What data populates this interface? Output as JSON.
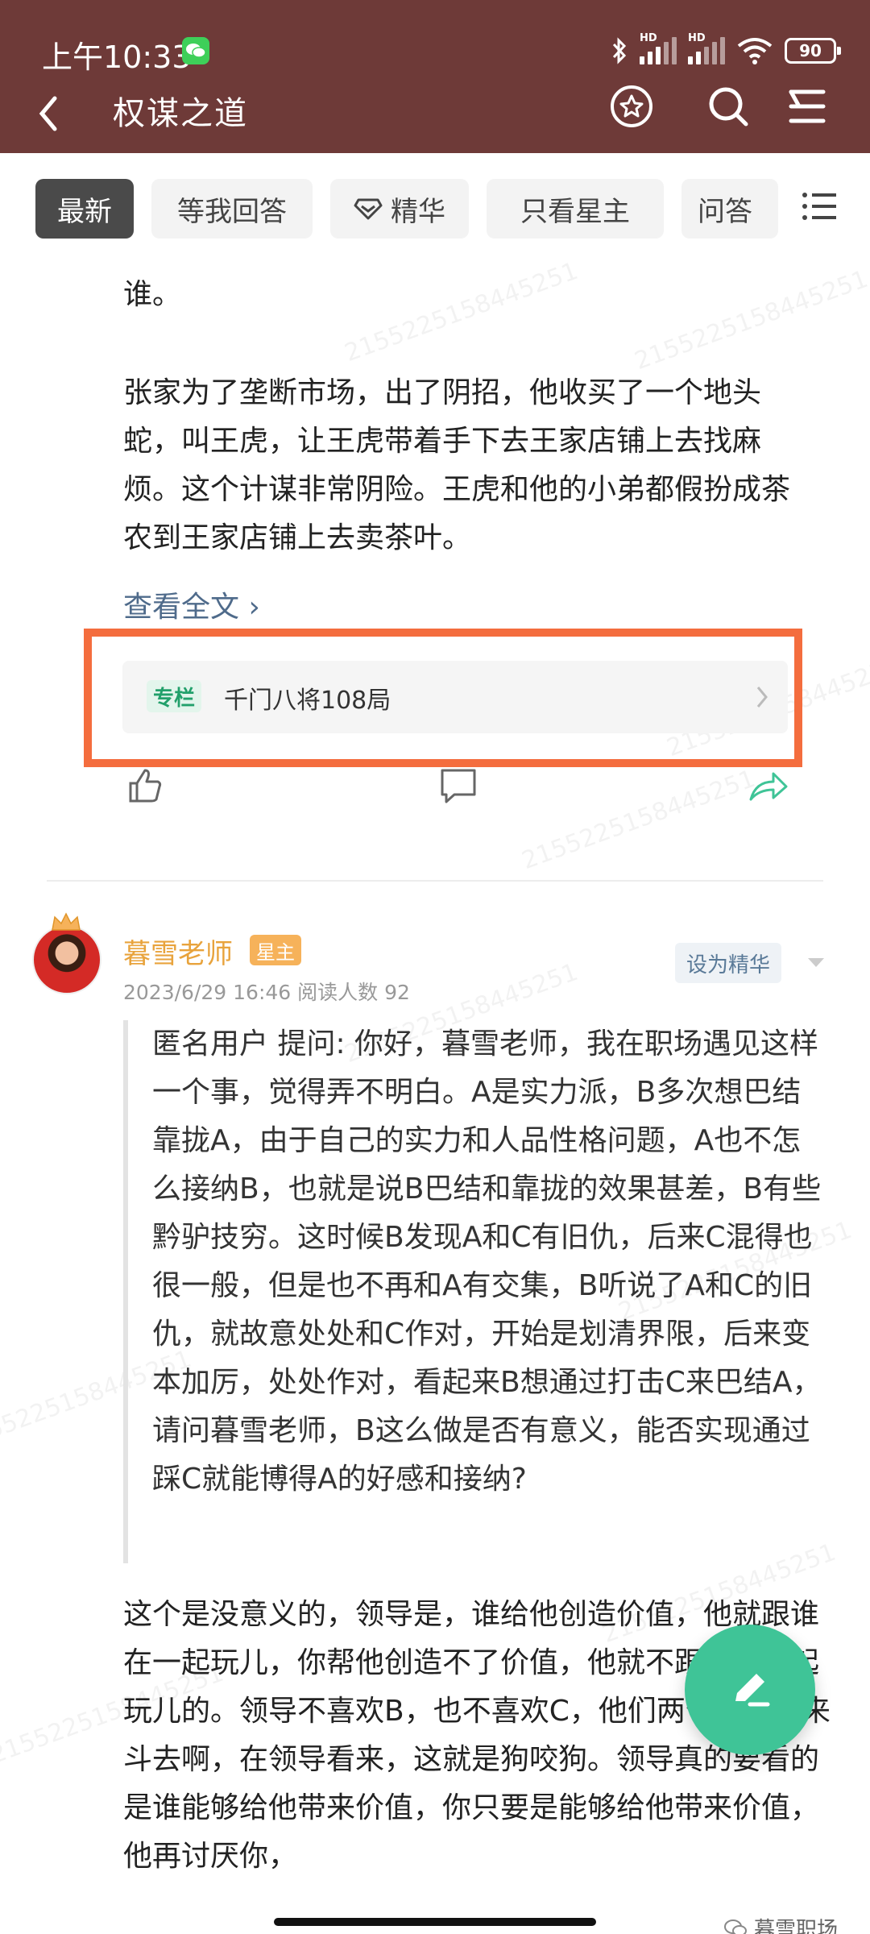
{
  "status": {
    "time": "上午10:33",
    "battery": "90",
    "sig_label": "HD"
  },
  "nav": {
    "title": "权谋之道"
  },
  "tabs": [
    {
      "label": "最新"
    },
    {
      "label": "等我回答"
    },
    {
      "label": "精华"
    },
    {
      "label": "只看星主"
    },
    {
      "label": "问答"
    }
  ],
  "article1": {
    "line0": "谁。",
    "paragraph": "张家为了垄断市场，出了阴招，他收买了一个地头蛇，叫王虎，让王虎带着手下去王家店铺上去找麻烦。这个计谋非常阴险。王虎和他的小弟都假扮成茶农到王家店铺上去卖茶叶。",
    "read_more": "查看全文 ›",
    "column_tag": "专栏",
    "column_title": "千门八将108局"
  },
  "post2": {
    "author": "暮雪老师",
    "author_badge": "星主",
    "meta": "2023/6/29 16:46  阅读人数 92",
    "feature_button": "设为精华",
    "question": "匿名用户 提问: 你好，暮雪老师，我在职场遇见这样一个事，觉得弄不明白。A是实力派，B多次想巴结靠拢A，由于自己的实力和人品性格问题，A也不怎么接纳B，也就是说B巴结和靠拢的效果甚差，B有些黔驴技穷。这时候B发现A和C有旧仇，后来C混得也很一般，但是也不再和A有交集，B听说了A和C的旧仇，就故意处处和C作对，开始是划清界限，后来变本加厉，处处作对，看起来B想通过打击C来巴结A，请问暮雪老师，B这么做是否有意义，能否实现通过踩C就能博得A的好感和接纳?",
    "answer": "这个是没意义的，领导是，谁给他创造价值，他就跟谁在一起玩儿，你帮他创造不了价值，他就不跟你在一起玩儿的。领导不喜欢B，也不喜欢C，他们两个相互斗来斗去啊，在领导看来，这就是狗咬狗。领导真的要看的是谁能够给他带来价值，你只要是能够给他带来价值，他再讨厌你，"
  },
  "footer": {
    "wechat_mark": "暮雪职场"
  },
  "watermark_text": "2155225158445251",
  "colors": {
    "topbar": "#6e3a38",
    "accent_green": "#3fc497",
    "highlight_orange": "#f46d3e",
    "author_gold": "#e8a33c"
  }
}
